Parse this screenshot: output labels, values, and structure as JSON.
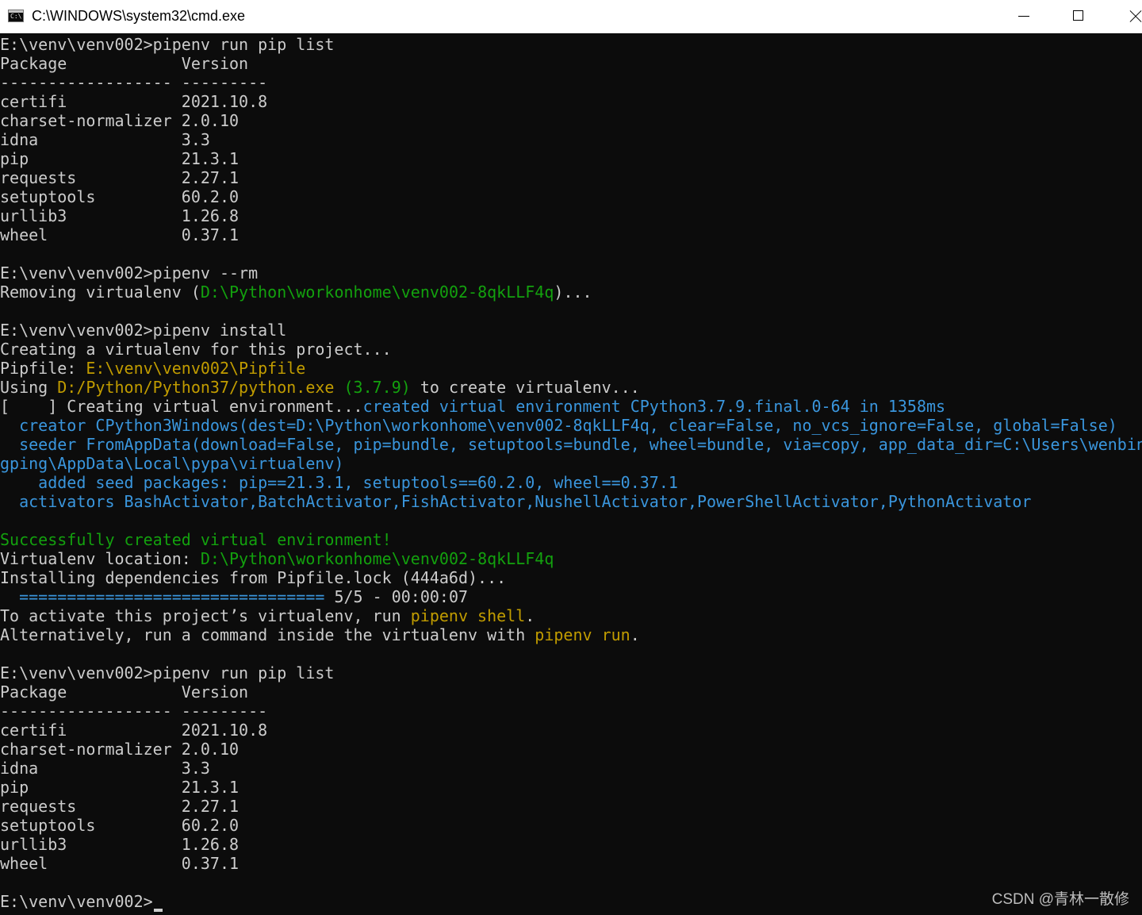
{
  "window": {
    "title": "C:\\WINDOWS\\system32\\cmd.exe",
    "icon": "cmd-icon",
    "icon_glyph": "C:\\"
  },
  "colors": {
    "background": "#0c0c0c",
    "text": "#cccccc",
    "green": "#13a10e",
    "blue": "#3a96dd",
    "yellow": "#c19c00"
  },
  "console": {
    "lines": [
      [
        [
          "w",
          "E:\\venv\\venv002>pipenv run pip list"
        ]
      ],
      [
        [
          "w",
          "Package            Version"
        ]
      ],
      [
        [
          "w",
          "------------------ ---------"
        ]
      ],
      [
        [
          "w",
          "certifi            2021.10.8"
        ]
      ],
      [
        [
          "w",
          "charset-normalizer 2.0.10"
        ]
      ],
      [
        [
          "w",
          "idna               3.3"
        ]
      ],
      [
        [
          "w",
          "pip                21.3.1"
        ]
      ],
      [
        [
          "w",
          "requests           2.27.1"
        ]
      ],
      [
        [
          "w",
          "setuptools         60.2.0"
        ]
      ],
      [
        [
          "w",
          "urllib3            1.26.8"
        ]
      ],
      [
        [
          "w",
          "wheel              0.37.1"
        ]
      ],
      [
        [
          "w",
          ""
        ]
      ],
      [
        [
          "w",
          "E:\\venv\\venv002>pipenv --rm"
        ]
      ],
      [
        [
          "w",
          "Removing virtualenv ("
        ],
        [
          "g",
          "D:\\Python\\workonhome\\venv002-8qkLLF4q"
        ],
        [
          "w",
          ")..."
        ]
      ],
      [
        [
          "w",
          ""
        ]
      ],
      [
        [
          "w",
          "E:\\venv\\venv002>pipenv install"
        ]
      ],
      [
        [
          "w",
          "Creating a virtualenv for this project..."
        ]
      ],
      [
        [
          "w",
          "Pipfile: "
        ],
        [
          "y",
          "E:\\venv\\venv002\\Pipfile"
        ]
      ],
      [
        [
          "w",
          "Using "
        ],
        [
          "y",
          "D:/Python/Python37/python.exe"
        ],
        [
          "w",
          " "
        ],
        [
          "g",
          "(3.7.9)"
        ],
        [
          "w",
          " to create virtualenv..."
        ]
      ],
      [
        [
          "w",
          "[    ] Creating virtual environment..."
        ],
        [
          "b",
          "created virtual environment CPython3.7.9.final.0-64 in 1358ms"
        ]
      ],
      [
        [
          "b",
          "  creator CPython3Windows(dest=D:\\Python\\workonhome\\venv002-8qkLLF4q, clear=False, no_vcs_ignore=False, global=False)"
        ]
      ],
      [
        [
          "b",
          "  seeder FromAppData(download=False, pip=bundle, setuptools=bundle, wheel=bundle, via=copy, app_data_dir=C:\\Users\\wenbin"
        ]
      ],
      [
        [
          "b",
          "gping\\AppData\\Local\\pypa\\virtualenv)"
        ]
      ],
      [
        [
          "b",
          "    added seed packages: pip==21.3.1, setuptools==60.2.0, wheel==0.37.1"
        ]
      ],
      [
        [
          "b",
          "  activators BashActivator,BatchActivator,FishActivator,NushellActivator,PowerShellActivator,PythonActivator"
        ]
      ],
      [
        [
          "w",
          ""
        ]
      ],
      [
        [
          "g",
          "Successfully created virtual environment!"
        ]
      ],
      [
        [
          "w",
          "Virtualenv location: "
        ],
        [
          "g",
          "D:\\Python\\workonhome\\venv002-8qkLLF4q"
        ]
      ],
      [
        [
          "w",
          "Installing dependencies from Pipfile.lock (444a6d)..."
        ]
      ],
      [
        [
          "b",
          "  ================================"
        ],
        [
          "w",
          " 5/5 - 00:00:07"
        ]
      ],
      [
        [
          "w",
          "To activate this project’s virtualenv, run "
        ],
        [
          "y",
          "pipenv shell"
        ],
        [
          "w",
          "."
        ]
      ],
      [
        [
          "w",
          "Alternatively, run a command inside the virtualenv with "
        ],
        [
          "y",
          "pipenv run"
        ],
        [
          "w",
          "."
        ]
      ],
      [
        [
          "w",
          ""
        ]
      ],
      [
        [
          "w",
          "E:\\venv\\venv002>pipenv run pip list"
        ]
      ],
      [
        [
          "w",
          "Package            Version"
        ]
      ],
      [
        [
          "w",
          "------------------ ---------"
        ]
      ],
      [
        [
          "w",
          "certifi            2021.10.8"
        ]
      ],
      [
        [
          "w",
          "charset-normalizer 2.0.10"
        ]
      ],
      [
        [
          "w",
          "idna               3.3"
        ]
      ],
      [
        [
          "w",
          "pip                21.3.1"
        ]
      ],
      [
        [
          "w",
          "requests           2.27.1"
        ]
      ],
      [
        [
          "w",
          "setuptools         60.2.0"
        ]
      ],
      [
        [
          "w",
          "urllib3            1.26.8"
        ]
      ],
      [
        [
          "w",
          "wheel              0.37.1"
        ]
      ],
      [
        [
          "w",
          ""
        ]
      ],
      [
        [
          "w",
          "E:\\venv\\venv002>"
        ]
      ]
    ]
  },
  "watermark": "CSDN @青林一散修"
}
